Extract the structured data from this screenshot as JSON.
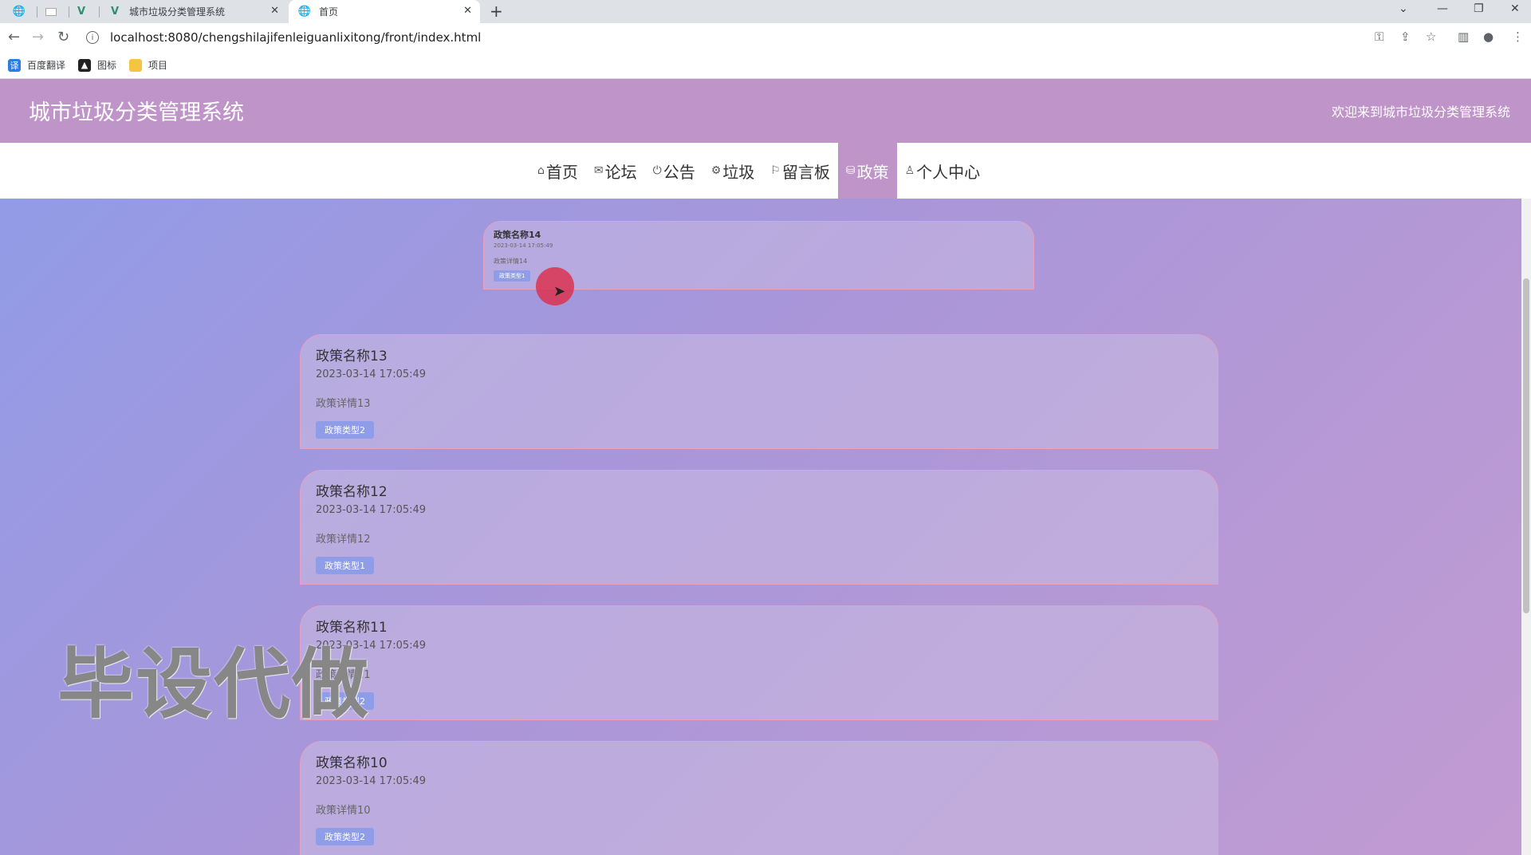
{
  "browser": {
    "tabs": [
      {
        "title": "城市垃圾分类管理系统",
        "icon": "vue-icon"
      },
      {
        "title": "首页",
        "icon": "globe-icon"
      }
    ],
    "url": "localhost:8080/chengshilajifenleiguanlixitong/front/index.html",
    "bookmarks": [
      "百度翻译",
      "图标",
      "项目"
    ]
  },
  "header": {
    "site_title": "城市垃圾分类管理系统",
    "welcome": "欢迎来到城市垃圾分类管理系统"
  },
  "nav": {
    "items": [
      {
        "label": "首页",
        "icon": "home-icon"
      },
      {
        "label": "论坛",
        "icon": "mail-icon"
      },
      {
        "label": "公告",
        "icon": "power-icon"
      },
      {
        "label": "垃圾",
        "icon": "gear-icon"
      },
      {
        "label": "留言板",
        "icon": "flag-icon"
      },
      {
        "label": "政策",
        "icon": "database-icon"
      },
      {
        "label": "个人中心",
        "icon": "user-icon"
      }
    ],
    "active": "政策"
  },
  "policies": [
    {
      "name": "政策名称14",
      "time": "2023-03-14 17:05:49",
      "detail": "政策详情14",
      "type": "政策类型1"
    },
    {
      "name": "政策名称13",
      "time": "2023-03-14 17:05:49",
      "detail": "政策详情13",
      "type": "政策类型2"
    },
    {
      "name": "政策名称12",
      "time": "2023-03-14 17:05:49",
      "detail": "政策详情12",
      "type": "政策类型1"
    },
    {
      "name": "政策名称11",
      "time": "2023-03-14 17:05:49",
      "detail": "政策详情11",
      "type": "政策类型2"
    },
    {
      "name": "政策名称10",
      "time": "2023-03-14 17:05:49",
      "detail": "政策详情10",
      "type": "政策类型2"
    }
  ],
  "watermark": "毕设代做",
  "colors": {
    "header": "#bf94c8",
    "tag": "#8f9ce8",
    "card_border": "#e89fc0"
  }
}
